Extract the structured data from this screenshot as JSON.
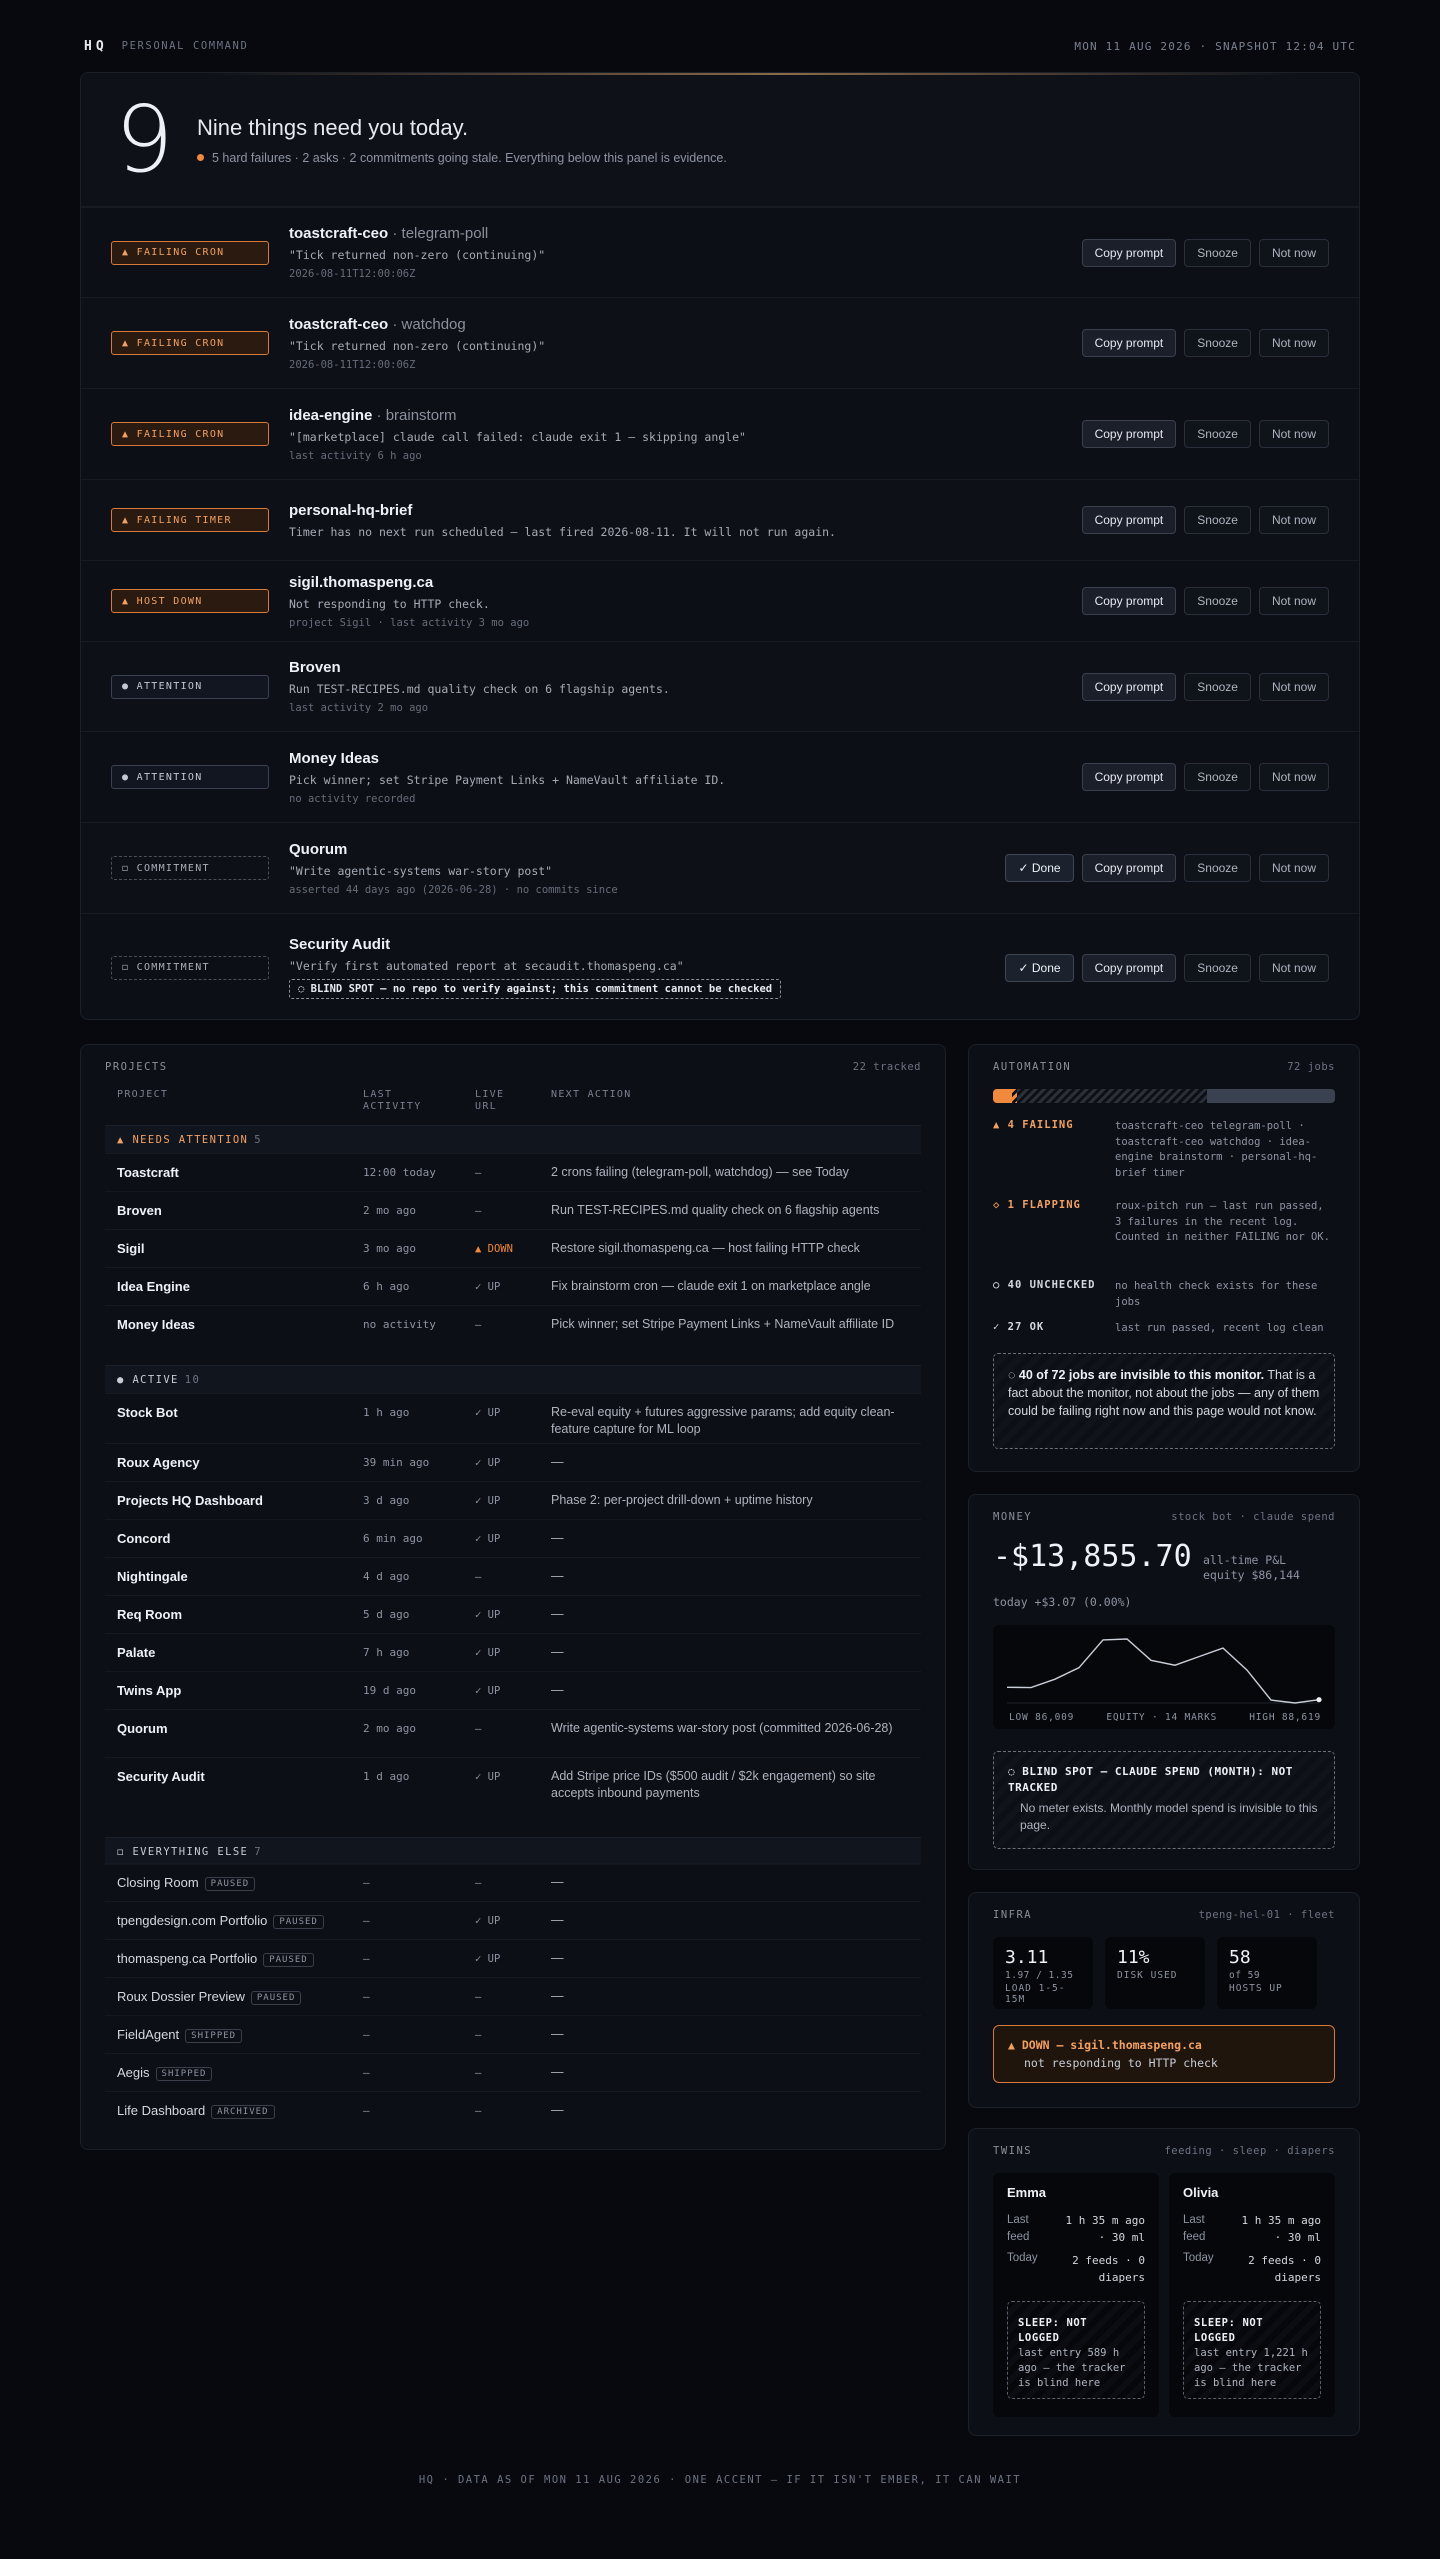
{
  "header": {
    "brand": "HQ",
    "subtitle": "PERSONAL COMMAND",
    "date": "MON 11 AUG 2026 · SNAPSHOT 12:04 UTC"
  },
  "today": {
    "count": "9",
    "title": "Nine things need you today.",
    "summary": "5 hard failures · 2 asks · 2 commitments going stale. Everything below this panel is evidence.",
    "labels": {
      "copy": "Copy prompt",
      "snooze": "Snooze",
      "not_now": "Not now",
      "done": "✓ Done"
    },
    "items": [
      {
        "badge": "▲ FAILING CRON",
        "name": "toastcraft-ceo",
        "sub": " · telegram-poll",
        "desc": "\"Tick returned non-zero (continuing)\"",
        "meta": "2026-08-11T12:00:06Z"
      },
      {
        "badge": "▲ FAILING CRON",
        "name": "toastcraft-ceo",
        "sub": " · watchdog",
        "desc": "\"Tick returned non-zero (continuing)\"",
        "meta": "2026-08-11T12:00:06Z"
      },
      {
        "badge": "▲ FAILING CRON",
        "name": "idea-engine",
        "sub": " · brainstorm",
        "desc": "\"[marketplace] claude call failed: claude exit 1 — skipping angle\"",
        "meta": "last activity 6 h ago"
      },
      {
        "badge": "▲ FAILING TIMER",
        "name": "personal-hq-brief",
        "sub": "",
        "desc": "Timer has no next run scheduled — last fired 2026-08-11. It will not run again.",
        "meta": ""
      },
      {
        "badge": "▲ HOST DOWN",
        "name": "sigil.thomaspeng.ca",
        "sub": "",
        "desc": "Not responding to HTTP check.",
        "meta": "project Sigil · last activity 3 mo ago"
      },
      {
        "badge": "● ATTENTION",
        "name": "Broven",
        "sub": "",
        "desc": "Run TEST-RECIPES.md quality check on 6 flagship agents.",
        "meta": "last activity 2 mo ago"
      },
      {
        "badge": "● ATTENTION",
        "name": "Money Ideas",
        "sub": "",
        "desc": "Pick winner; set Stripe Payment Links + NameVault affiliate ID.",
        "meta": "no activity recorded"
      },
      {
        "badge": "◻ COMMITMENT",
        "name": "Quorum",
        "sub": "",
        "desc": "\"Write agentic-systems war-story post\"",
        "meta": "asserted 44 days ago (2026-06-28) · no commits since"
      },
      {
        "badge": "◻ COMMITMENT",
        "name": "Security Audit",
        "sub": "",
        "desc": "\"Verify first automated report at secaudit.thomaspeng.ca\"",
        "meta": "",
        "blind": "◌ BLIND SPOT — no repo to verify against; this commitment cannot be checked"
      }
    ]
  },
  "projects": {
    "title": "PROJECTS",
    "count": "22 tracked",
    "cols": {
      "project": "PROJECT",
      "last": "LAST\nACTIVITY",
      "live": "LIVE\nURL",
      "next": "NEXT ACTION"
    },
    "groups": [
      {
        "label": "▲ NEEDS ATTENTION",
        "count": "5"
      },
      {
        "label": "● ACTIVE",
        "count": "10"
      },
      {
        "label": "◻ EVERYTHING ELSE",
        "count": "7"
      }
    ],
    "rows": [
      {
        "name": "Toastcraft",
        "last": "12:00 today",
        "url": "—",
        "next": "2 crons failing (telegram-poll, watchdog) — see Today"
      },
      {
        "name": "Broven",
        "last": "2 mo ago",
        "url": "—",
        "next": "Run TEST-RECIPES.md quality check on 6 flagship agents"
      },
      {
        "name": "Sigil",
        "last": "3 mo ago",
        "url": "▲ DOWN",
        "next": "Restore sigil.thomaspeng.ca — host failing HTTP check"
      },
      {
        "name": "Idea Engine",
        "last": "6 h ago",
        "url": "✓ UP",
        "next": "Fix brainstorm cron — claude exit 1 on marketplace angle"
      },
      {
        "name": "Money Ideas",
        "last": "no activity",
        "url": "—",
        "next": "Pick winner; set Stripe Payment Links + NameVault affiliate ID"
      },
      {
        "name": "Stock Bot",
        "last": "1 h ago",
        "url": "✓ UP",
        "next": "Re-eval equity + futures aggressive params; add equity clean-feature capture for ML loop"
      },
      {
        "name": "Roux Agency",
        "last": "39 min ago",
        "url": "✓ UP",
        "next": "—"
      },
      {
        "name": "Projects HQ Dashboard",
        "last": "3 d ago",
        "url": "✓ UP",
        "next": "Phase 2: per-project drill-down + uptime history"
      },
      {
        "name": "Concord",
        "last": "6 min ago",
        "url": "✓ UP",
        "next": "—"
      },
      {
        "name": "Nightingale",
        "last": "4 d ago",
        "url": "—",
        "next": "—"
      },
      {
        "name": "Req Room",
        "last": "5 d ago",
        "url": "✓ UP",
        "next": "—"
      },
      {
        "name": "Palate",
        "last": "7 h ago",
        "url": "✓ UP",
        "next": "—"
      },
      {
        "name": "Twins App",
        "last": "19 d ago",
        "url": "✓ UP",
        "next": "—"
      },
      {
        "name": "Quorum",
        "last": "2 mo ago",
        "url": "—",
        "next": "Write agentic-systems war-story post (committed 2026-06-28)"
      },
      {
        "name": "Security Audit",
        "last": "1 d ago",
        "url": "✓ UP",
        "next": "Add Stripe price IDs ($500 audit / $2k engagement) so site accepts inbound payments"
      },
      {
        "name": "Closing Room",
        "tag": "PAUSED",
        "last": "—",
        "url": "—",
        "next": "—"
      },
      {
        "name": "tpengdesign.com Portfolio",
        "tag": "PAUSED",
        "last": "—",
        "url": "✓ UP",
        "next": "—"
      },
      {
        "name": "thomaspeng.ca Portfolio",
        "tag": "PAUSED",
        "last": "—",
        "url": "✓ UP",
        "next": "—"
      },
      {
        "name": "Roux Dossier Preview",
        "tag": "PAUSED",
        "last": "—",
        "url": "—",
        "next": "—"
      },
      {
        "name": "FieldAgent",
        "tag": "SHIPPED",
        "last": "—",
        "url": "—",
        "next": "—"
      },
      {
        "name": "Aegis",
        "tag": "SHIPPED",
        "last": "—",
        "url": "—",
        "next": "—"
      },
      {
        "name": "Life Dashboard",
        "tag": "ARCHIVED",
        "last": "—",
        "url": "—",
        "next": "—"
      }
    ]
  },
  "automation": {
    "title": "AUTOMATION",
    "count": "72 jobs",
    "bar": {
      "failing": 4,
      "flapping": 1,
      "unchecked": 40,
      "ok": 27,
      "total": 72
    },
    "rows": [
      {
        "k": "▲ 4 FAILING",
        "v": "toastcraft-ceo telegram-poll · toastcraft-ceo watchdog · idea-engine brainstorm · personal-hq-brief timer"
      },
      {
        "k": "◇ 1 FLAPPING",
        "v": "roux-pitch run — last run passed, 3 failures in the recent log. Counted in neither FAILING nor OK."
      },
      {
        "k": "○ 40 UNCHECKED",
        "v": "no health check exists for these jobs"
      },
      {
        "k": "✓ 27 OK",
        "v": "last run passed, recent log clean"
      }
    ],
    "note_strong": "◌ 40 of 72 jobs are invisible to this monitor.",
    "note_rest": " That is a fact about the monitor, not about the jobs — any of them could be failing right now and this page would not know."
  },
  "money": {
    "title": "MONEY",
    "tags": "stock bot · claude spend",
    "pnl": "-$13,855.70",
    "pnl_label": "all-time P&L",
    "equity": "equity $86,144",
    "today": "today +$3.07 (0.00%)",
    "low": "LOW 86,009",
    "mid": "EQUITY · 14 MARKS",
    "high": "HIGH 88,619",
    "blind_title": "◌ BLIND SPOT — CLAUDE SPEND (MONTH): NOT TRACKED",
    "blind_body": "No meter exists. Monthly model spend is invisible to this page."
  },
  "chart_data": {
    "type": "line",
    "title": "",
    "xlabel": "",
    "ylabel": "",
    "series": [
      {
        "values": [
          86650,
          86640,
          86980,
          87450,
          88580,
          88619,
          87750,
          87550,
          87900,
          88250,
          87350,
          86130,
          86009,
          86144
        ]
      }
    ],
    "ylim": [
      86009,
      88619
    ]
  },
  "infra": {
    "title": "INFRA",
    "host": "tpeng-hel-01 · fleet",
    "stats": [
      {
        "n": "3.11",
        "s1": "1.97 / 1.35",
        "s2": "LOAD 1-5-15M"
      },
      {
        "n": "11%",
        "s1": "",
        "s2": "DISK USED"
      },
      {
        "n": "58",
        "s1": "of 59",
        "s2": "HOSTS UP"
      }
    ],
    "alert_title": "▲ DOWN — sigil.thomaspeng.ca",
    "alert_body": "not responding to HTTP check"
  },
  "twins": {
    "title": "TWINS",
    "tags": "feeding · sleep · diapers",
    "people": [
      {
        "name": "Emma",
        "last_feed_label": "Last feed",
        "last_feed": "1 h 35 m ago\n· 30 ml",
        "today_label": "Today",
        "today": "2 feeds · 0\ndiapers",
        "sleep_title": "SLEEP: NOT LOGGED",
        "sleep_body": "last entry 589 h ago — the tracker is blind here"
      },
      {
        "name": "Olivia",
        "last_feed_label": "Last feed",
        "last_feed": "1 h 35 m ago\n· 30 ml",
        "today_label": "Today",
        "today": "2 feeds · 0\ndiapers",
        "sleep_title": "SLEEP: NOT LOGGED",
        "sleep_body": "last entry 1,221 h ago — the tracker is blind here"
      }
    ]
  },
  "footer": "HQ · DATA AS OF MON 11 AUG 2026 · ONE ACCENT — IF IT ISN'T EMBER, IT CAN WAIT",
  "colors": {
    "ember": "#f08a3e",
    "bg": "#07090e",
    "card": "#0c0f15"
  }
}
